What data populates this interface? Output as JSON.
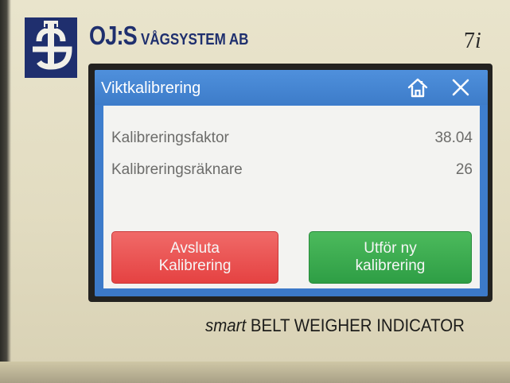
{
  "device": {
    "brand_main": "OJ:S",
    "brand_sub": "VÅGSYSTEM AB",
    "model_number": "7",
    "model_suffix": "i",
    "footer_smart": "smart",
    "footer_rest": " BELT WEIGHER INDICATOR"
  },
  "dialog": {
    "title": "Viktkalibrering",
    "home_icon": "home-icon",
    "close_icon": "close-icon"
  },
  "fields": [
    {
      "label": "Kalibreringsfaktor",
      "value": "38.04"
    },
    {
      "label": "Kalibreringsräknare",
      "value": "26"
    }
  ],
  "buttons": {
    "cancel_line1": "Avsluta",
    "cancel_line2": "Kalibrering",
    "redo_line1": "Utför ny",
    "redo_line2": "kalibrering"
  },
  "colors": {
    "brand_blue": "#1f2f6e",
    "titlebar_blue": "#3d7cc9",
    "cancel_red": "#e54242",
    "confirm_green": "#2e9e45"
  }
}
